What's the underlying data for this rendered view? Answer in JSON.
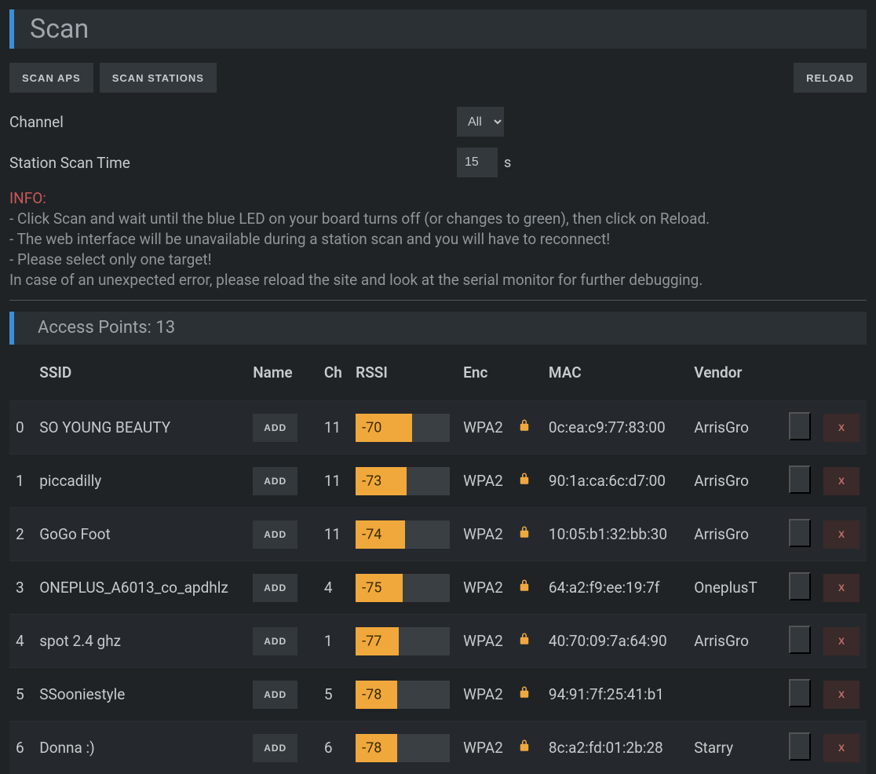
{
  "header": {
    "title": "Scan"
  },
  "actions": {
    "scan_aps": "SCAN APS",
    "scan_stations": "SCAN STATIONS",
    "reload": "RELOAD"
  },
  "settings": {
    "channel_label": "Channel",
    "channel_value": "All",
    "station_scan_time_label": "Station Scan Time",
    "station_scan_time_value": "15",
    "station_scan_time_unit": "s"
  },
  "info": {
    "label": "INFO:",
    "line1": "- Click Scan and wait until the blue LED on your board turns off (or changes to green), then click on Reload.",
    "line2": "- The web interface will be unavailable during a station scan and you will have to reconnect!",
    "line3": "- Please select only one target!",
    "line4": "In case of an unexpected error, please reload the site and look at the serial monitor for further debugging."
  },
  "aps": {
    "title": "Access Points: 13",
    "headers": {
      "ssid": "SSID",
      "name": "Name",
      "ch": "Ch",
      "rssi": "RSSI",
      "enc": "Enc",
      "mac": "MAC",
      "vendor": "Vendor"
    },
    "add_label": "ADD",
    "remove_label": "X",
    "rows": [
      {
        "id": "0",
        "ssid": "SO YOUNG BEAUTY",
        "ch": "11",
        "rssi": -70,
        "enc": "WPA2",
        "mac": "0c:ea:c9:77:83:00",
        "vendor": "ArrisGro"
      },
      {
        "id": "1",
        "ssid": "piccadilly",
        "ch": "11",
        "rssi": -73,
        "enc": "WPA2",
        "mac": "90:1a:ca:6c:d7:00",
        "vendor": "ArrisGro"
      },
      {
        "id": "2",
        "ssid": "GoGo Foot",
        "ch": "11",
        "rssi": -74,
        "enc": "WPA2",
        "mac": "10:05:b1:32:bb:30",
        "vendor": "ArrisGro"
      },
      {
        "id": "3",
        "ssid": "ONEPLUS_A6013_co_apdhlz",
        "ch": "4",
        "rssi": -75,
        "enc": "WPA2",
        "mac": "64:a2:f9:ee:19:7f",
        "vendor": "OneplusT"
      },
      {
        "id": "4",
        "ssid": "spot 2.4 ghz",
        "ch": "1",
        "rssi": -77,
        "enc": "WPA2",
        "mac": "40:70:09:7a:64:90",
        "vendor": "ArrisGro"
      },
      {
        "id": "5",
        "ssid": "SSooniestyle",
        "ch": "5",
        "rssi": -78,
        "enc": "WPA2",
        "mac": "94:91:7f:25:41:b1",
        "vendor": ""
      },
      {
        "id": "6",
        "ssid": "Donna :)",
        "ch": "6",
        "rssi": -78,
        "enc": "WPA2",
        "mac": "8c:a2:fd:01:2b:28",
        "vendor": "Starry"
      }
    ]
  }
}
